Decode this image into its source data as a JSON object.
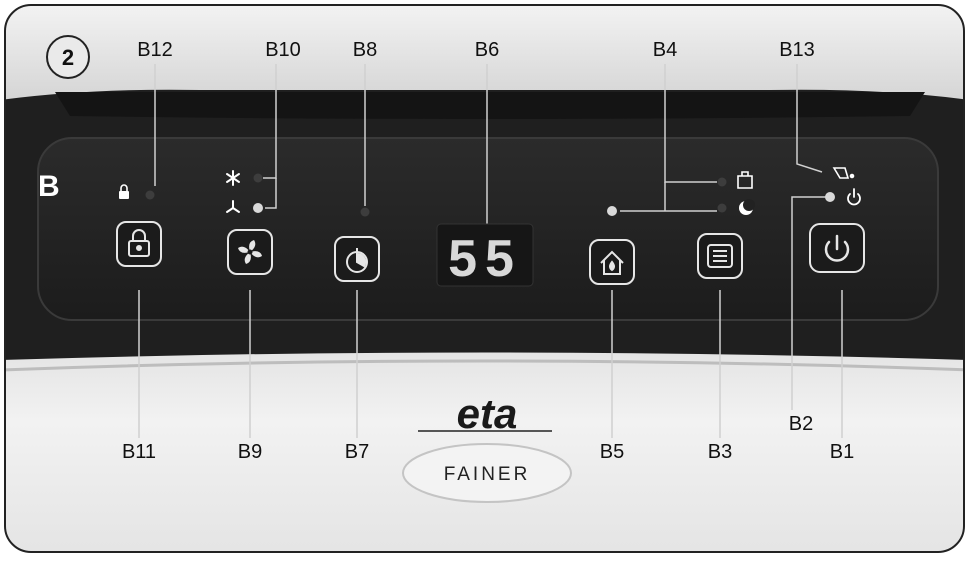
{
  "figure": {
    "number": "2",
    "panel_label": "B"
  },
  "callouts": {
    "b1": "B1",
    "b2": "B2",
    "b3": "B3",
    "b4": "B4",
    "b5": "B5",
    "b6": "B6",
    "b7": "B7",
    "b8": "B8",
    "b9": "B9",
    "b10": "B10",
    "b11": "B11",
    "b12": "B12",
    "b13": "B13"
  },
  "display": {
    "value": "55",
    "color": "#d8d8d8"
  },
  "brand": {
    "logo_text": "eta",
    "product_name": "FAINER"
  },
  "colors": {
    "panel": "#262626",
    "panel_edge": "#3a3a3a",
    "button_stroke": "#e6e6e6",
    "led_off": "#3d3d3d",
    "led_on": "#d9d9d9",
    "body": "#ececec"
  },
  "icons": {
    "b11": "lock-icon",
    "b9": "fan-icon",
    "b7": "timer-icon",
    "b5": "home-drop-icon",
    "b3": "menu-list-icon",
    "b1": "power-icon",
    "b12_indicator": "small-lock-icon",
    "b10_high": "fan-high-icon",
    "b10_low": "fan-low-icon",
    "b4_laundry": "laundry-icon",
    "b4_sleep": "sleep-moon-icon",
    "b13": "tank-full-icon",
    "b2_power": "small-power-icon"
  }
}
